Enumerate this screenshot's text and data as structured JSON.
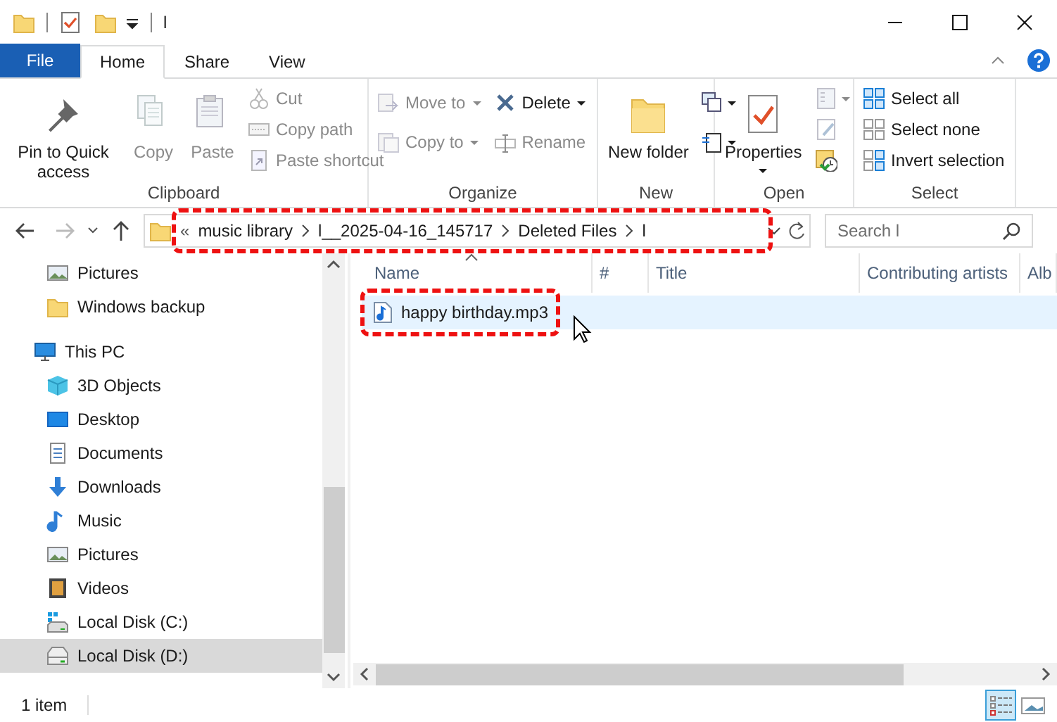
{
  "window": {
    "title": "l"
  },
  "tabs": [
    {
      "label": "File",
      "kind": "file",
      "selected": false
    },
    {
      "label": "Home",
      "kind": "tab",
      "selected": true
    },
    {
      "label": "Share",
      "kind": "tab",
      "selected": false
    },
    {
      "label": "View",
      "kind": "tab",
      "selected": false
    }
  ],
  "ribbon": [
    {
      "label": "Clipboard",
      "columns": [
        [
          {
            "kind": "large",
            "label": "Pin to Quick access",
            "disabled": false
          }
        ],
        [
          {
            "kind": "large",
            "label": "Copy",
            "disabled": true
          }
        ],
        [
          {
            "kind": "large",
            "label": "Paste",
            "disabled": true
          }
        ],
        [
          {
            "kind": "small",
            "label": "Cut",
            "disabled": true
          },
          {
            "kind": "small",
            "label": "Copy path",
            "disabled": true
          },
          {
            "kind": "small",
            "label": "Paste shortcut",
            "disabled": true
          }
        ]
      ]
    },
    {
      "label": "Organize",
      "columns": [
        [
          {
            "kind": "small",
            "label": "Move to",
            "disabled": true,
            "caret": true
          },
          {
            "kind": "small",
            "label": "Copy to",
            "disabled": true,
            "caret": true
          }
        ],
        [
          {
            "kind": "small",
            "label": "Delete",
            "disabled": false,
            "caret": true
          },
          {
            "kind": "small",
            "label": "Rename",
            "disabled": true
          }
        ]
      ]
    },
    {
      "label": "New",
      "columns": [
        [
          {
            "kind": "large",
            "label": "New folder",
            "disabled": false
          }
        ],
        [
          {
            "kind": "icon",
            "disabled": false,
            "caret": true
          },
          {
            "kind": "icon",
            "disabled": false,
            "caret": true
          }
        ]
      ]
    },
    {
      "label": "Open",
      "columns": [
        [
          {
            "kind": "large",
            "label": "Properties",
            "disabled": false,
            "caret": true
          }
        ],
        [
          {
            "kind": "icon",
            "disabled": true,
            "caret": true
          },
          {
            "kind": "icon",
            "disabled": true
          },
          {
            "kind": "icon",
            "disabled": false
          }
        ]
      ]
    },
    {
      "label": "Select",
      "columns": [
        [
          {
            "kind": "small",
            "label": "Select all",
            "disabled": false
          },
          {
            "kind": "small",
            "label": "Select none",
            "disabled": false
          },
          {
            "kind": "small",
            "label": "Invert selection",
            "disabled": false
          }
        ]
      ]
    }
  ],
  "address": {
    "highlighted": true,
    "overflow": "«",
    "crumbs": [
      "music library",
      "l__2025-04-16_145717",
      "Deleted Files",
      "l"
    ]
  },
  "search": {
    "placeholder": "Search l"
  },
  "sidebar": {
    "items": [
      {
        "label": "Pictures",
        "kind": "pinned",
        "selected": false
      },
      {
        "label": "Windows backup",
        "kind": "pinned",
        "selected": false
      },
      {
        "label": "This PC",
        "kind": "root",
        "selected": false,
        "children": [
          {
            "label": "3D Objects",
            "selected": false
          },
          {
            "label": "Desktop",
            "selected": false
          },
          {
            "label": "Documents",
            "selected": false
          },
          {
            "label": "Downloads",
            "selected": false
          },
          {
            "label": "Music",
            "selected": false
          },
          {
            "label": "Pictures",
            "selected": false
          },
          {
            "label": "Videos",
            "selected": false
          },
          {
            "label": "Local Disk (C:)",
            "selected": false
          },
          {
            "label": "Local Disk (D:)",
            "selected": true
          }
        ]
      }
    ]
  },
  "table": {
    "columns": [
      "Name",
      "#",
      "Title",
      "Contributing artists",
      "Alb"
    ],
    "rows": [
      {
        "name": "happy birthday.mp3",
        "selected": true,
        "highlighted": true
      }
    ]
  },
  "status_bar": {
    "count": "1 item",
    "views": [
      {
        "kind": "details",
        "selected": true
      },
      {
        "kind": "large-icons",
        "selected": false
      }
    ]
  }
}
